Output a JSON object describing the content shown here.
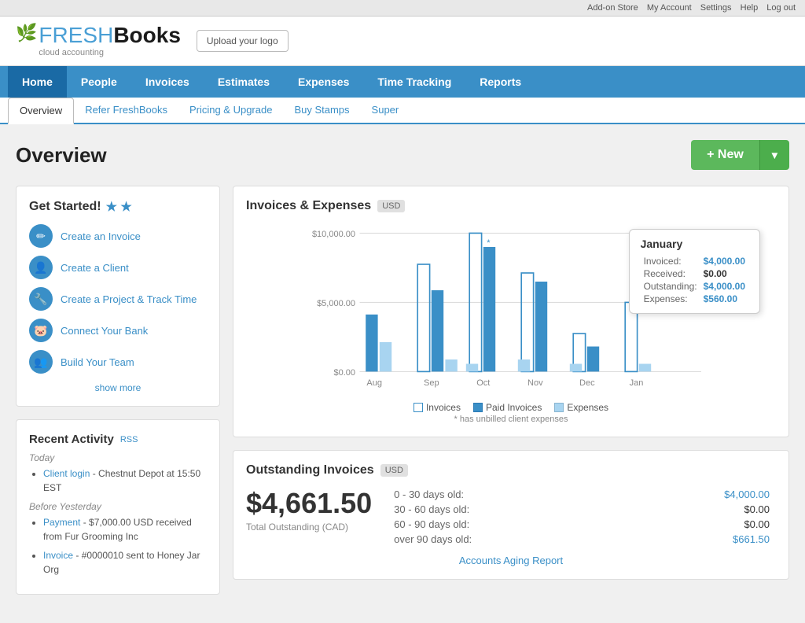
{
  "topbar": {
    "links": [
      "Add-on Store",
      "My Account",
      "Settings",
      "Help",
      "Log out"
    ]
  },
  "header": {
    "logo_fresh": "FRESH",
    "logo_books": "Books",
    "logo_sub": "cloud accounting",
    "upload_btn": "Upload your logo"
  },
  "mainnav": {
    "items": [
      {
        "label": "Home",
        "active": true
      },
      {
        "label": "People"
      },
      {
        "label": "Invoices"
      },
      {
        "label": "Estimates"
      },
      {
        "label": "Expenses"
      },
      {
        "label": "Time Tracking"
      },
      {
        "label": "Reports"
      }
    ]
  },
  "subnav": {
    "items": [
      {
        "label": "Overview",
        "active": true
      },
      {
        "label": "Refer FreshBooks"
      },
      {
        "label": "Pricing & Upgrade"
      },
      {
        "label": "Buy Stamps"
      },
      {
        "label": "Super"
      }
    ]
  },
  "page": {
    "title": "Overview",
    "new_btn": "+ New"
  },
  "get_started": {
    "heading": "Get Started!",
    "links": [
      {
        "label": "Create an Invoice",
        "icon": "✏️"
      },
      {
        "label": "Create a Client",
        "icon": "👤"
      },
      {
        "label": "Create a Project & Track Time",
        "icon": "🔧"
      },
      {
        "label": "Connect Your Bank",
        "icon": "🐷"
      },
      {
        "label": "Build Your Team",
        "icon": "👥"
      }
    ],
    "show_more": "show more"
  },
  "recent_activity": {
    "heading": "Recent Activity",
    "rss": "RSS",
    "today_label": "Today",
    "today_items": [
      {
        "link_text": "Client login",
        "rest": " - Chestnut Depot at 15:50 EST"
      }
    ],
    "before_yesterday_label": "Before Yesterday",
    "before_yesterday_items": [
      {
        "link_text": "Payment",
        "rest": " - $7,000.00 USD received from Fur Grooming Inc"
      },
      {
        "link_text": "Invoice",
        "rest": " - #0000010 sent to Honey Jar Org"
      }
    ]
  },
  "chart": {
    "heading": "Invoices & Expenses",
    "currency": "USD",
    "labels": [
      "Aug",
      "Sep",
      "Oct",
      "Nov",
      "Dec",
      "Jan"
    ],
    "y_labels": [
      "$10,000.00",
      "$5,000.00",
      "$0.00"
    ],
    "legend": [
      "Invoices",
      "Paid Invoices",
      "Expenses"
    ],
    "note": "* has unbilled client expenses",
    "tooltip": {
      "month": "January",
      "invoiced_label": "Invoiced:",
      "invoiced_value": "$4,000.00",
      "received_label": "Received:",
      "received_value": "$0.00",
      "outstanding_label": "Outstanding:",
      "outstanding_value": "$4,000.00",
      "expenses_label": "Expenses:",
      "expenses_value": "$560.00"
    }
  },
  "outstanding": {
    "heading": "Outstanding Invoices",
    "currency": "USD",
    "total": "$4,661.50",
    "total_label": "Total Outstanding (CAD)",
    "rows": [
      {
        "label": "0 - 30 days old:",
        "value": "$4,000.00",
        "is_link": true
      },
      {
        "label": "30 - 60 days old:",
        "value": "$0.00",
        "is_link": false
      },
      {
        "label": "60 - 90 days old:",
        "value": "$0.00",
        "is_link": false
      },
      {
        "label": "over 90 days old:",
        "value": "$661.50",
        "is_link": true
      }
    ],
    "aging_report": "Accounts Aging Report"
  }
}
